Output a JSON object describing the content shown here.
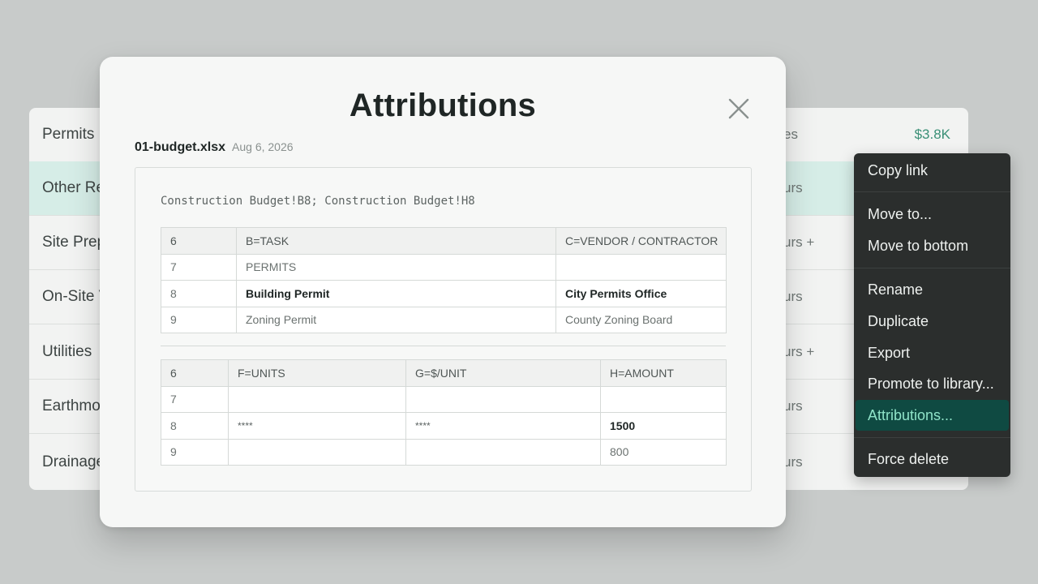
{
  "background_list": {
    "rows": [
      {
        "label": "Permits",
        "right_label": "es",
        "amount": "$3.8K",
        "selected": false
      },
      {
        "label": "Other Re",
        "right_label": "urs",
        "amount": "",
        "selected": true
      },
      {
        "label": "Site Prep",
        "right_label": "urs +",
        "amount": "",
        "selected": false
      },
      {
        "label": "On-Site V",
        "right_label": "urs",
        "amount": "",
        "selected": false
      },
      {
        "label": "Utilities",
        "right_label": "urs +",
        "amount": "",
        "selected": false
      },
      {
        "label": "Earthmo",
        "right_label": "urs",
        "amount": "",
        "selected": false
      },
      {
        "label": "Drainage",
        "right_label": "urs",
        "amount": "",
        "selected": false
      }
    ]
  },
  "modal": {
    "title": "Attributions",
    "close_icon": "close-icon",
    "file_name": "01-budget.xlsx",
    "file_date": "Aug 6, 2026",
    "refs": "Construction Budget!B8; Construction Budget!H8",
    "table1": {
      "headers": [
        "6",
        "B=TASK",
        "C=VENDOR / CONTRACTOR"
      ],
      "rows": [
        [
          "7",
          "PERMITS",
          ""
        ],
        [
          "8",
          "Building Permit",
          "City Permits Office"
        ],
        [
          "9",
          "Zoning Permit",
          "County Zoning Board"
        ]
      ]
    },
    "table2": {
      "headers": [
        "6",
        "F=UNITS",
        "G=$/UNIT",
        "H=AMOUNT"
      ],
      "rows": [
        [
          "7",
          "",
          "",
          ""
        ],
        [
          "8",
          "****",
          "****",
          "1500"
        ],
        [
          "9",
          "",
          "",
          "800"
        ]
      ]
    }
  },
  "context_menu": {
    "items": [
      {
        "label": "Copy link"
      },
      {
        "label": "Move to..."
      },
      {
        "label": "Move to bottom"
      },
      {
        "label": "Rename"
      },
      {
        "label": "Duplicate"
      },
      {
        "label": "Export"
      },
      {
        "label": "Promote to library..."
      },
      {
        "label": "Attributions...",
        "active": true
      },
      {
        "label": "Force delete"
      }
    ]
  },
  "colors": {
    "accent": "#3a8f76",
    "selected_row": "#d6ede7",
    "menu_bg": "#2b2e2d",
    "menu_active": "#0f4a42"
  }
}
